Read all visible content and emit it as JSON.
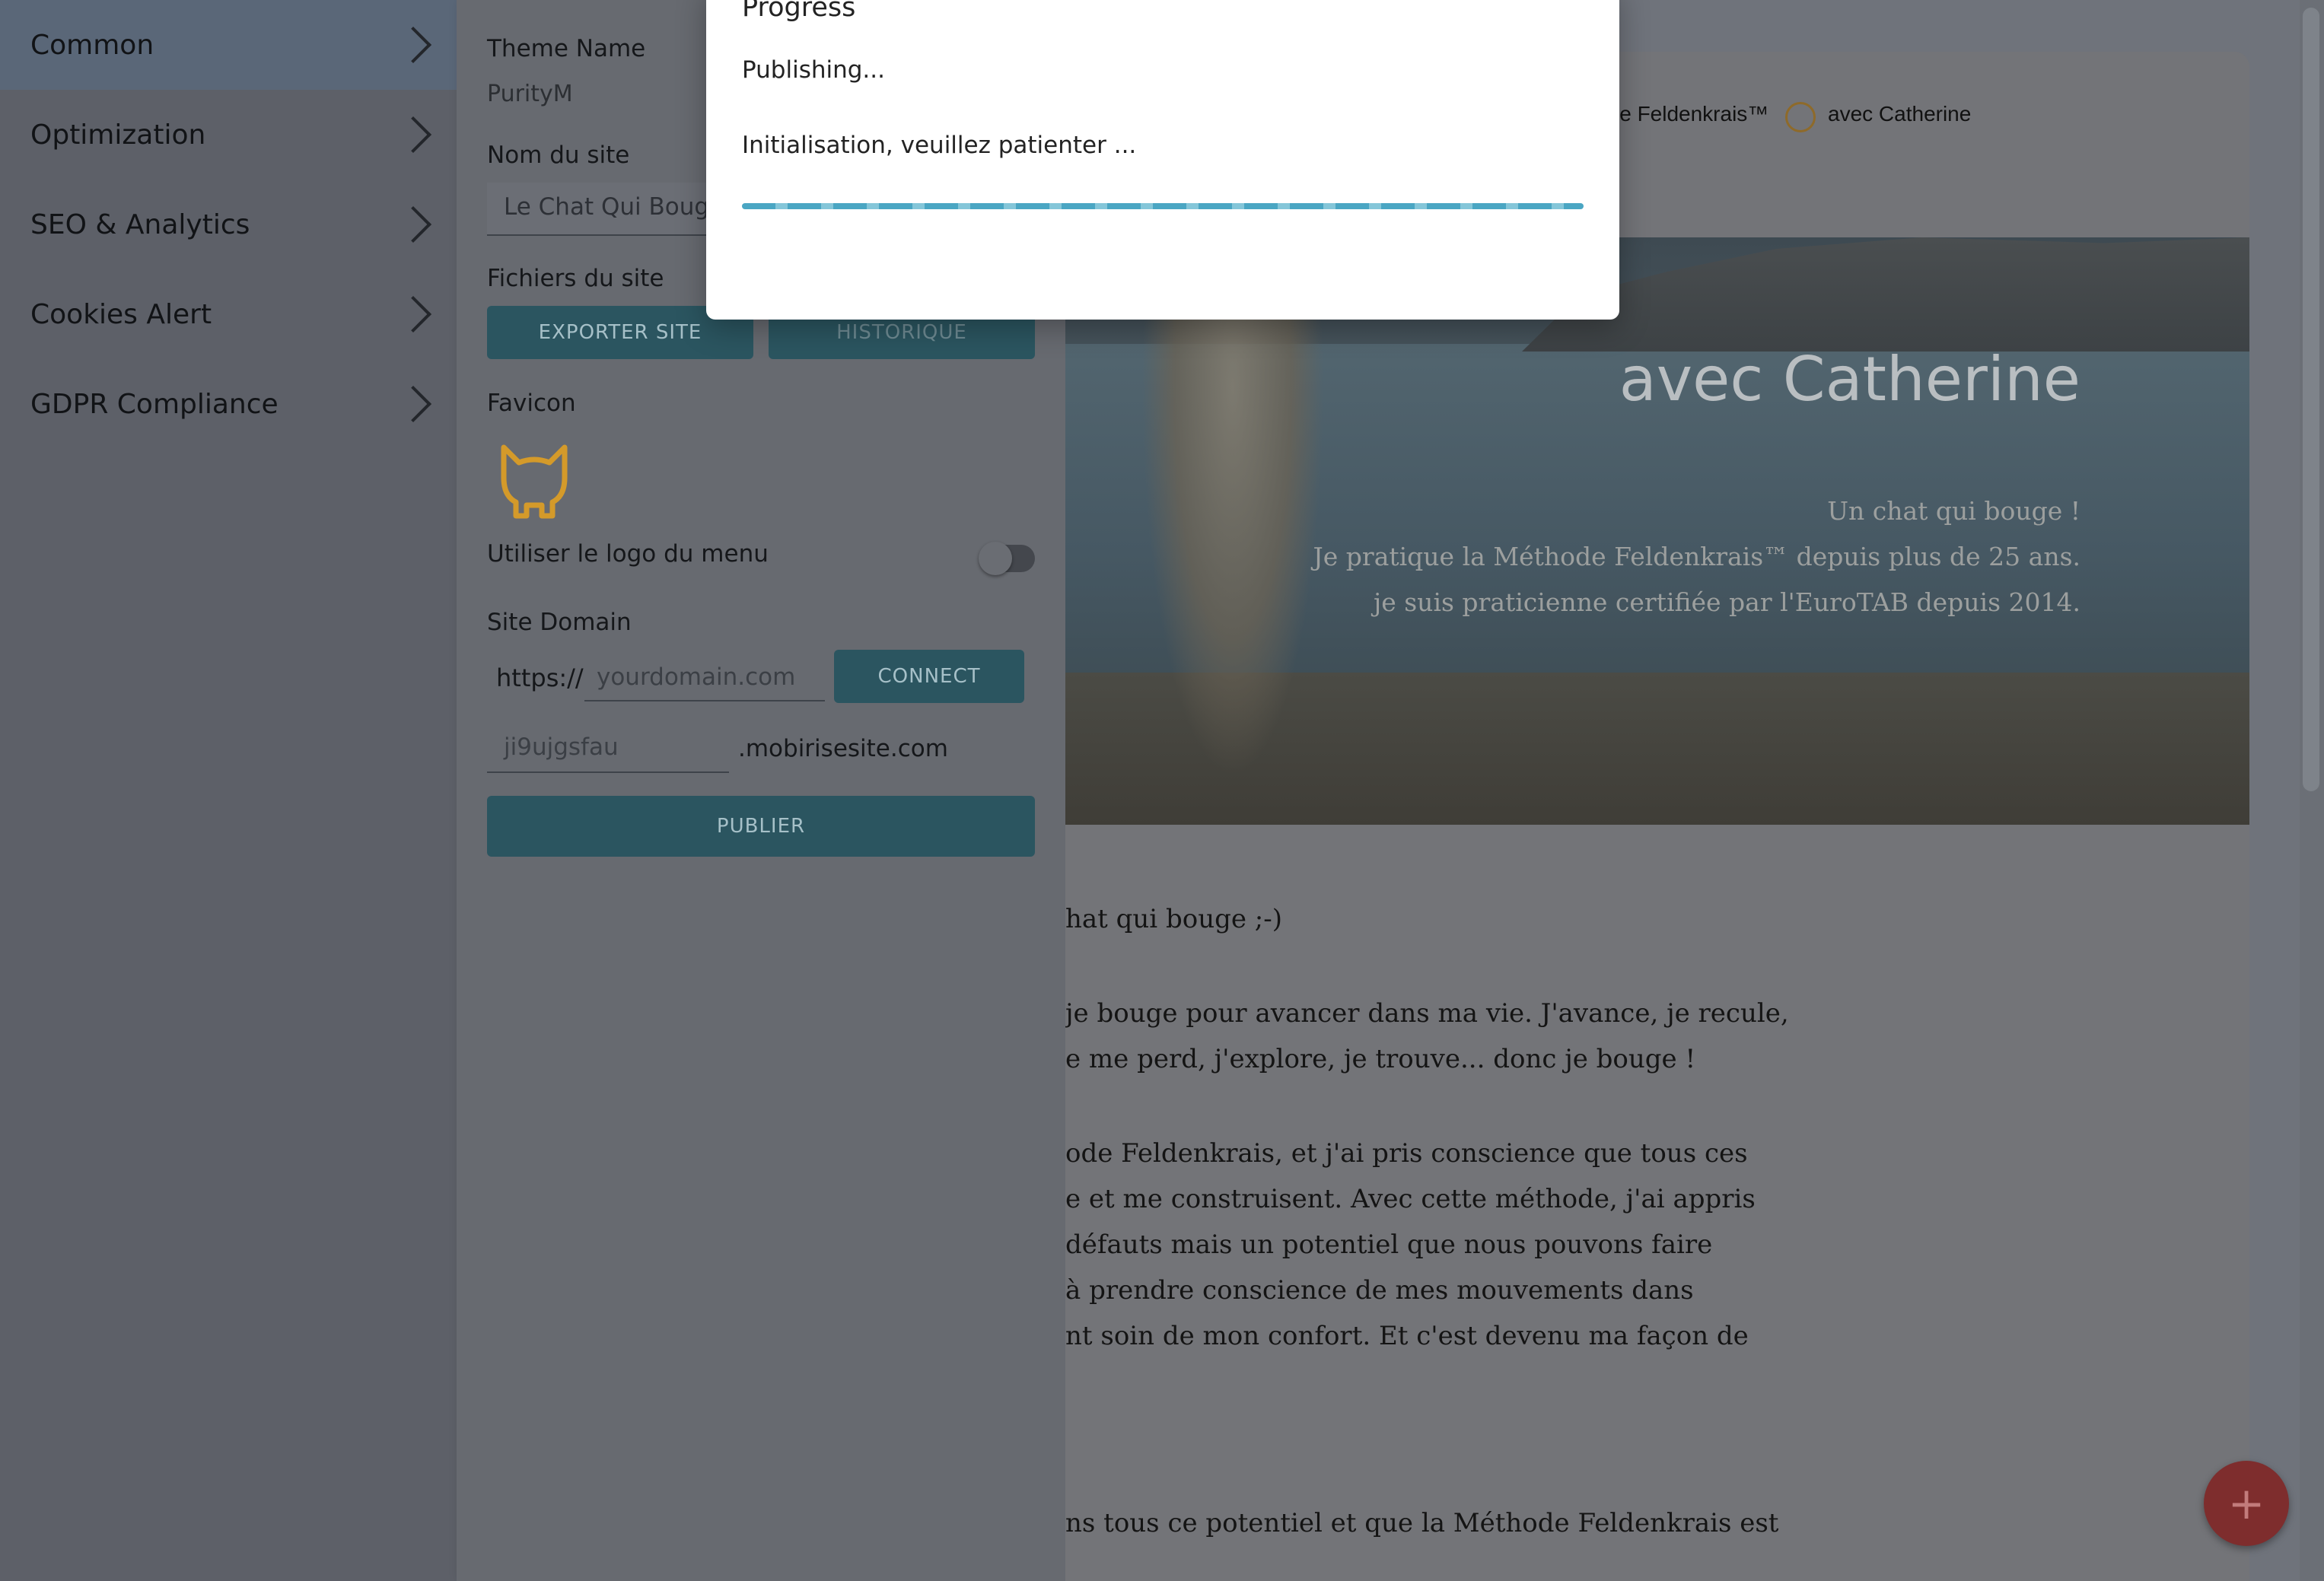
{
  "sidebar": {
    "items": [
      {
        "label": "Common"
      },
      {
        "label": "Optimization"
      },
      {
        "label": "SEO & Analytics"
      },
      {
        "label": "Cookies Alert"
      },
      {
        "label": "GDPR Compliance"
      }
    ]
  },
  "settings": {
    "theme_label": "Theme Name",
    "theme_value": "PurityM",
    "site_name_label": "Nom du site",
    "site_name_value": "Le Chat Qui Bouge",
    "site_files_label": "Fichiers du site",
    "export_button": "EXPORTER SITE",
    "history_button": "HISTORIQUE",
    "favicon_label": "Favicon",
    "menu_logo_label": "Utiliser le logo du menu",
    "menu_logo_enabled": false,
    "site_domain_label": "Site Domain",
    "protocol": "https://",
    "domain_placeholder": "yourdomain.com",
    "connect_button": "CONNECT",
    "subdomain_value": "ji9ujgsfau",
    "subdomain_suffix": ".mobirisesite.com",
    "publish_button": "PUBLIER"
  },
  "preview": {
    "nav_link_1": "le Feldenkrais™",
    "nav_link_2": "avec Catherine",
    "hero_title": "avec Catherine",
    "hero_lines": [
      "Un chat qui bouge !",
      "Je pratique la Méthode Feldenkrais™ depuis plus de 25 ans.",
      "je suis praticienne certifiée par l'EuroTAB depuis 2014."
    ],
    "body_lines": [
      "hat qui bouge ;-)",
      " je bouge pour avancer dans ma vie. J'avance, je recule,",
      "e me perd, j'explore, je trouve... donc je bouge !",
      "ode Feldenkrais, et j'ai pris conscience que tous ces",
      "e et me construisent. Avec cette méthode, j'ai appris",
      " défauts mais un potentiel que nous pouvons faire",
      "à prendre conscience de mes mouvements dans",
      "nt soin de mon confort. Et c'est devenu ma façon de",
      "ns tous ce potentiel et que la Méthode Feldenkrais est"
    ]
  },
  "dialog": {
    "title": "Progress",
    "status": "Publishing...",
    "message": "Initialisation, veuillez patienter ..."
  },
  "fab": {
    "symbol": "+"
  },
  "colors": {
    "accent": "#4aa6c3",
    "button_dark": "#2b5560",
    "fab": "#7e2d2d",
    "favicon": "#d49a2a"
  },
  "icons": {
    "chevron": "chevron-right-icon",
    "favicon": "cat-icon",
    "user": "user-circle-icon",
    "plus": "plus-icon"
  }
}
